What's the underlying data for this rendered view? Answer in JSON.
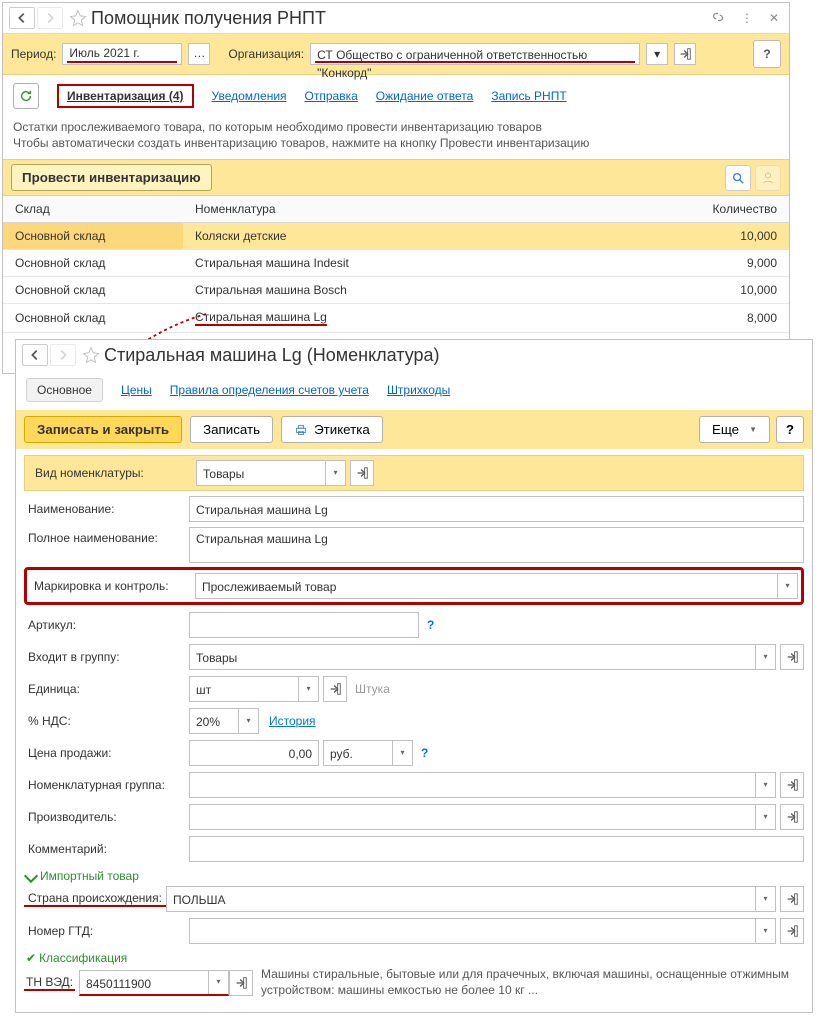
{
  "window1": {
    "title": "Помощник получения РНПТ",
    "period_label": "Период:",
    "period_value": "Июль 2021 г.",
    "org_label": "Организация:",
    "org_value": "СТ  Общество с ограниченной ответственностью \"Конкорд\"",
    "help": "?",
    "tabs": {
      "active": "Инвентаризация (4)",
      "t2": "Уведомления",
      "t3": "Отправка",
      "t4": "Ожидание ответа",
      "t5": "Запись РНПТ"
    },
    "desc_l1": "Остатки прослеживаемого товара, по которым необходимо провести инвентаризацию товаров",
    "desc_l2": "Чтобы автоматически создать инвентаризацию товаров, нажмите на кнопку Провести инвентаризацию",
    "action_btn": "Провести инвентаризацию",
    "cols": {
      "c1": "Склад",
      "c2": "Номенклатура",
      "c3": "Количество"
    },
    "rows": [
      {
        "sklad": "Основной склад",
        "nom": "Коляски детские",
        "qty": "10,000"
      },
      {
        "sklad": "Основной склад",
        "nom": "Стиральная машина Indesit",
        "qty": "9,000"
      },
      {
        "sklad": "Основной склад",
        "nom": "Стиральная машина Bosch",
        "qty": "10,000"
      },
      {
        "sklad": "Основной склад",
        "nom": "Стиральная машина Lg",
        "qty": "8,000"
      }
    ]
  },
  "window2": {
    "title": "Стиральная машина Lg (Номенклатура)",
    "tabs": {
      "t1": "Основное",
      "t2": "Цены",
      "t3": "Правила определения счетов учета",
      "t4": "Штрихкоды"
    },
    "toolbar": {
      "save_close": "Записать и закрыть",
      "save": "Записать",
      "label": "Этикетка",
      "more": "Еще",
      "help": "?"
    },
    "form": {
      "kind_label": "Вид номенклатуры:",
      "kind_value": "Товары",
      "name_label": "Наименование:",
      "name_value": "Стиральная машина Lg",
      "fullname_label": "Полное наименование:",
      "fullname_value": "Стиральная машина Lg",
      "mark_label": "Маркировка и контроль:",
      "mark_value": "Прослеживаемый товар",
      "sku_label": "Артикул:",
      "sku_value": "",
      "group_label": "Входит в группу:",
      "group_value": "Товары",
      "unit_label": "Единица:",
      "unit_value": "шт",
      "unit_hint": "Штука",
      "vat_label": "% НДС:",
      "vat_value": "20%",
      "history": "История",
      "price_label": "Цена продажи:",
      "price_value": "0,00",
      "currency": "руб.",
      "nomgroup_label": "Номенклатурная группа:",
      "manuf_label": "Производитель:",
      "comment_label": "Комментарий:",
      "import_section": "Импортный товар",
      "country_label": "Страна происхождения:",
      "country_value": "ПОЛЬША",
      "gtd_label": "Номер ГТД:",
      "classif_section": "Классификация",
      "tnved_label": "ТН ВЭД:",
      "tnved_value": "8450111900",
      "tnved_desc": "Машины стиральные, бытовые или для прачечных, включая машины, оснащенные отжимным устройством:  машины емкостью не более 10 кг ..."
    }
  }
}
